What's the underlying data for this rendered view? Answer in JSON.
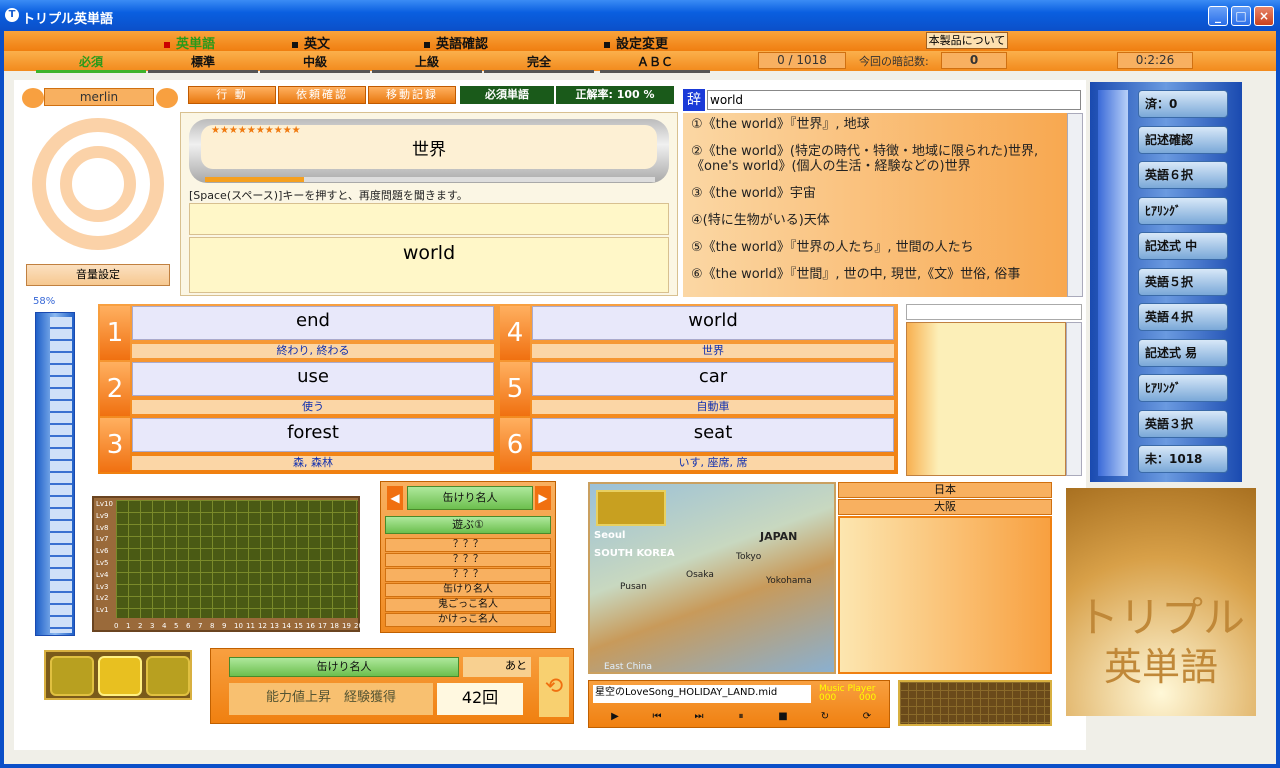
{
  "window": {
    "title": "トリプル英単語",
    "min": "_",
    "max": "□",
    "close": "×"
  },
  "menu": {
    "items": [
      "英単語",
      "英文",
      "英語確認",
      "設定変更"
    ],
    "about": "本製品について"
  },
  "tabs": [
    "必須",
    "標準",
    "中級",
    "上級",
    "完全",
    "ＡＢＣ"
  ],
  "status": {
    "progress": "0 / 1018",
    "memorized_label": "今回の暗記数:",
    "memorized": "0",
    "timer": "0:2:26"
  },
  "user": {
    "name": "merlin",
    "volume": "音量設定",
    "percent": "58%"
  },
  "actions": {
    "action": "行 動",
    "request": "依頼確認",
    "move_log": "移動記録",
    "category": "必須単語",
    "accuracy": "正解率: 100 %"
  },
  "question": {
    "stars": "★★★★★★★★★★",
    "prompt_word": "世界",
    "hint": "[Space(スペース)]キーを押すと、再度問題を聞きます。",
    "answer": "world"
  },
  "dict": {
    "badge": "辞",
    "query": "world",
    "lines": [
      "①《the world》『世界』, 地球",
      "②《the world》(特定の時代・特徴・地域に限られた)世界,《one's world》(個人の生活・経験などの)世界",
      "③《the world》宇宙",
      "④(特に生物がいる)天体",
      "⑤《the world》『世界の人たち』, 世間の人たち",
      "⑥《the world》『世間』, 世の中, 現世,《文》世俗, 俗事"
    ]
  },
  "choices": [
    {
      "n": "1",
      "word": "end",
      "mean": "終わり, 終わる"
    },
    {
      "n": "2",
      "word": "use",
      "mean": "使う"
    },
    {
      "n": "3",
      "word": "forest",
      "mean": "森, 森林"
    },
    {
      "n": "4",
      "word": "world",
      "mean": "世界"
    },
    {
      "n": "5",
      "word": "car",
      "mean": "自動車"
    },
    {
      "n": "6",
      "word": "seat",
      "mean": "いす, 座席, 席"
    }
  ],
  "sidebar": [
    "済：0",
    "記述確認",
    "英語６択",
    "ﾋｱﾘﾝｸﾞ",
    "記述式 中",
    "英語５択",
    "英語４択",
    "記述式 易",
    "ﾋｱﾘﾝｸﾞ",
    "英語３択",
    "未：1018"
  ],
  "games": {
    "title": "缶けり名人",
    "play": "遊ぶ①",
    "items": [
      "？？？",
      "？？？",
      "？？？",
      "缶けり名人",
      "鬼ごっこ名人",
      "かけっこ名人"
    ]
  },
  "bottom_game": {
    "name": "缶けり名人",
    "remaining": "あと",
    "stats": "能力値上昇　経験獲得",
    "count": "42回"
  },
  "map": {
    "country": "日本",
    "city": "大阪",
    "labels": [
      "Seoul",
      "SOUTH KOREA",
      "JAPAN",
      "Tokyo",
      "Yokohama",
      "Osaka",
      "Pusan",
      "East China"
    ]
  },
  "music": {
    "title": "星空のLoveSong_HOLIDAY_LAND.mid",
    "player": "Music Player",
    "t1": "000",
    "t2": "000"
  },
  "logo": {
    "line1": "トリプル",
    "line2": "英単語"
  },
  "chart": {
    "ylabels": [
      "Lv10",
      "Lv9",
      "Lv8",
      "Lv7",
      "Lv6",
      "Lv5",
      "Lv4",
      "Lv3",
      "Lv2",
      "Lv1"
    ],
    "xlabels": [
      "0",
      "1",
      "2",
      "3",
      "4",
      "5",
      "6",
      "7",
      "8",
      "9",
      "10",
      "11",
      "12",
      "13",
      "14",
      "15",
      "16",
      "17",
      "18",
      "19",
      "20"
    ]
  },
  "gauge": {
    "levels": [
      "100",
      "90",
      "80",
      "70",
      "60",
      "50",
      "40",
      "30",
      "20",
      "10",
      "0"
    ]
  },
  "colors": {
    "accent": "#f08a1c",
    "title": "#0b4fc8",
    "green": "#3db32a"
  }
}
